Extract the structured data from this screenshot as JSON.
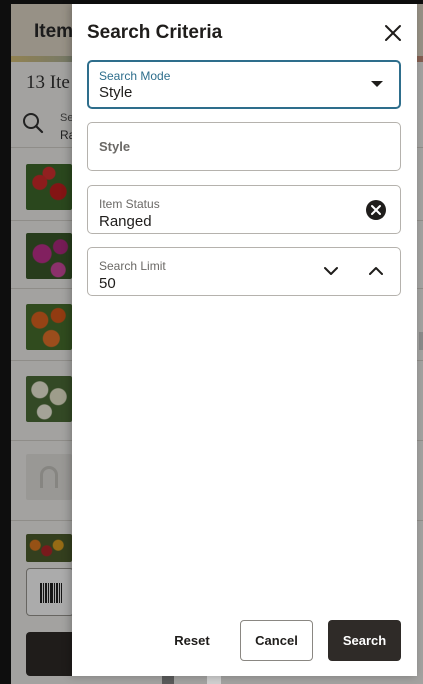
{
  "background": {
    "header_title": "Item",
    "count_text": "13 Ite",
    "search_label_1": "Se",
    "search_label_2": "Ra"
  },
  "drawer": {
    "title": "Search Criteria",
    "fields": {
      "search_mode": {
        "label": "Search Mode",
        "value": "Style"
      },
      "style": {
        "placeholder": "Style"
      },
      "item_status": {
        "label": "Item Status",
        "value": "Ranged"
      },
      "search_limit": {
        "label": "Search Limit",
        "value": "50"
      }
    },
    "buttons": {
      "reset": "Reset",
      "cancel": "Cancel",
      "search": "Search"
    }
  },
  "colors": {
    "focus_accent": "#2e6e8c",
    "primary_button": "#2f2b28"
  },
  "icons": [
    "search-icon",
    "barcode-icon",
    "close-icon",
    "caret-down-icon",
    "clear-icon",
    "chevron-down-icon",
    "chevron-up-icon"
  ]
}
